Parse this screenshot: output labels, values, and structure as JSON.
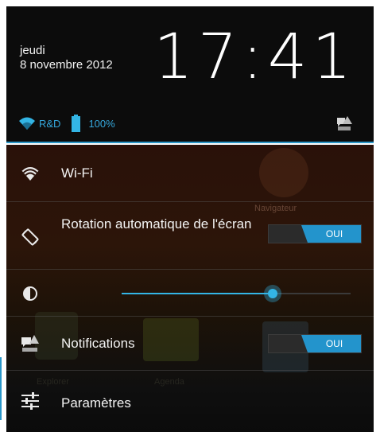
{
  "header": {
    "day": "jeudi",
    "date": "8 novembre 2012",
    "time": "17:41",
    "network_name": "R&D",
    "battery_percent": "100%",
    "status_icons": [
      "wifi-icon",
      "battery-icon",
      "notifications-toggle-icon"
    ]
  },
  "background": {
    "browser_label": "Navigateur",
    "explorer_label": "Explorer",
    "agenda_label": "Agenda"
  },
  "quick_settings": {
    "wifi": {
      "label": "Wi-Fi",
      "icon": "wifi-icon"
    },
    "rotation": {
      "label": "Rotation automatique de l'écran",
      "icon": "rotation-icon",
      "toggle_label": "OUI",
      "enabled": true
    },
    "brightness": {
      "icon": "brightness-icon",
      "level": 0.66
    },
    "notifications": {
      "label": "Notifications",
      "icon": "notifications-icon",
      "toggle_label": "OUI",
      "enabled": true
    },
    "settings": {
      "label": "Paramètres",
      "icon": "settings-sliders-icon"
    }
  },
  "colors": {
    "accent": "#33b5e5",
    "toggle_on": "#2394cc",
    "header_bg": "#0c0c0c",
    "text": "#f3f3f3"
  }
}
